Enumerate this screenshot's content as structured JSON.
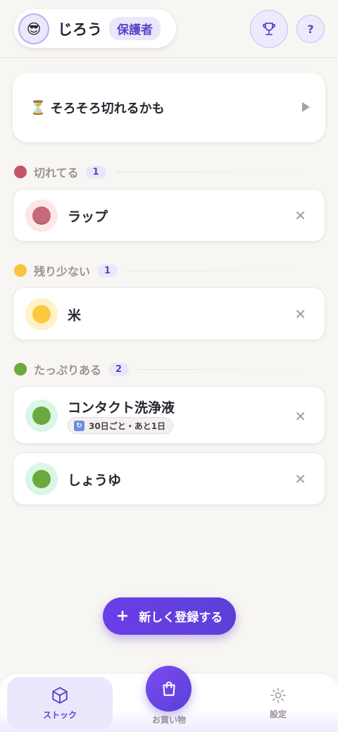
{
  "header": {
    "avatar_emoji": "😎",
    "user_name": "じろう",
    "role": "保護者"
  },
  "alert": {
    "icon": "⏳",
    "text": "そろそろ切れるかも"
  },
  "sections": [
    {
      "title": "切れてる",
      "count": "1",
      "color": "#c4546b",
      "items": [
        {
          "name": "ラップ",
          "dot_color": "#c46a78",
          "bg_color": "#fde6e8"
        }
      ]
    },
    {
      "title": "残り少ない",
      "count": "1",
      "color": "#f8c53c",
      "items": [
        {
          "name": "米",
          "dot_color": "#fbc93d",
          "bg_color": "#fff2c9"
        }
      ]
    },
    {
      "title": "たっぷりある",
      "count": "2",
      "color": "#6aa840",
      "items": [
        {
          "name": "コンタクト洗浄液",
          "dot_color": "#6aa840",
          "bg_color": "#d9f7e4",
          "cycle": "30日ごと・あと1日"
        },
        {
          "name": "しょうゆ",
          "dot_color": "#6aa840",
          "bg_color": "#d9f7e4"
        }
      ]
    }
  ],
  "fab": {
    "plus": "+",
    "label": "新しく登録する"
  },
  "nav": {
    "stock": "ストック",
    "shopping": "お買い物",
    "settings": "設定"
  },
  "colors": {
    "accent": "#5b45c9",
    "accent_bg": "#ebe7fb"
  }
}
